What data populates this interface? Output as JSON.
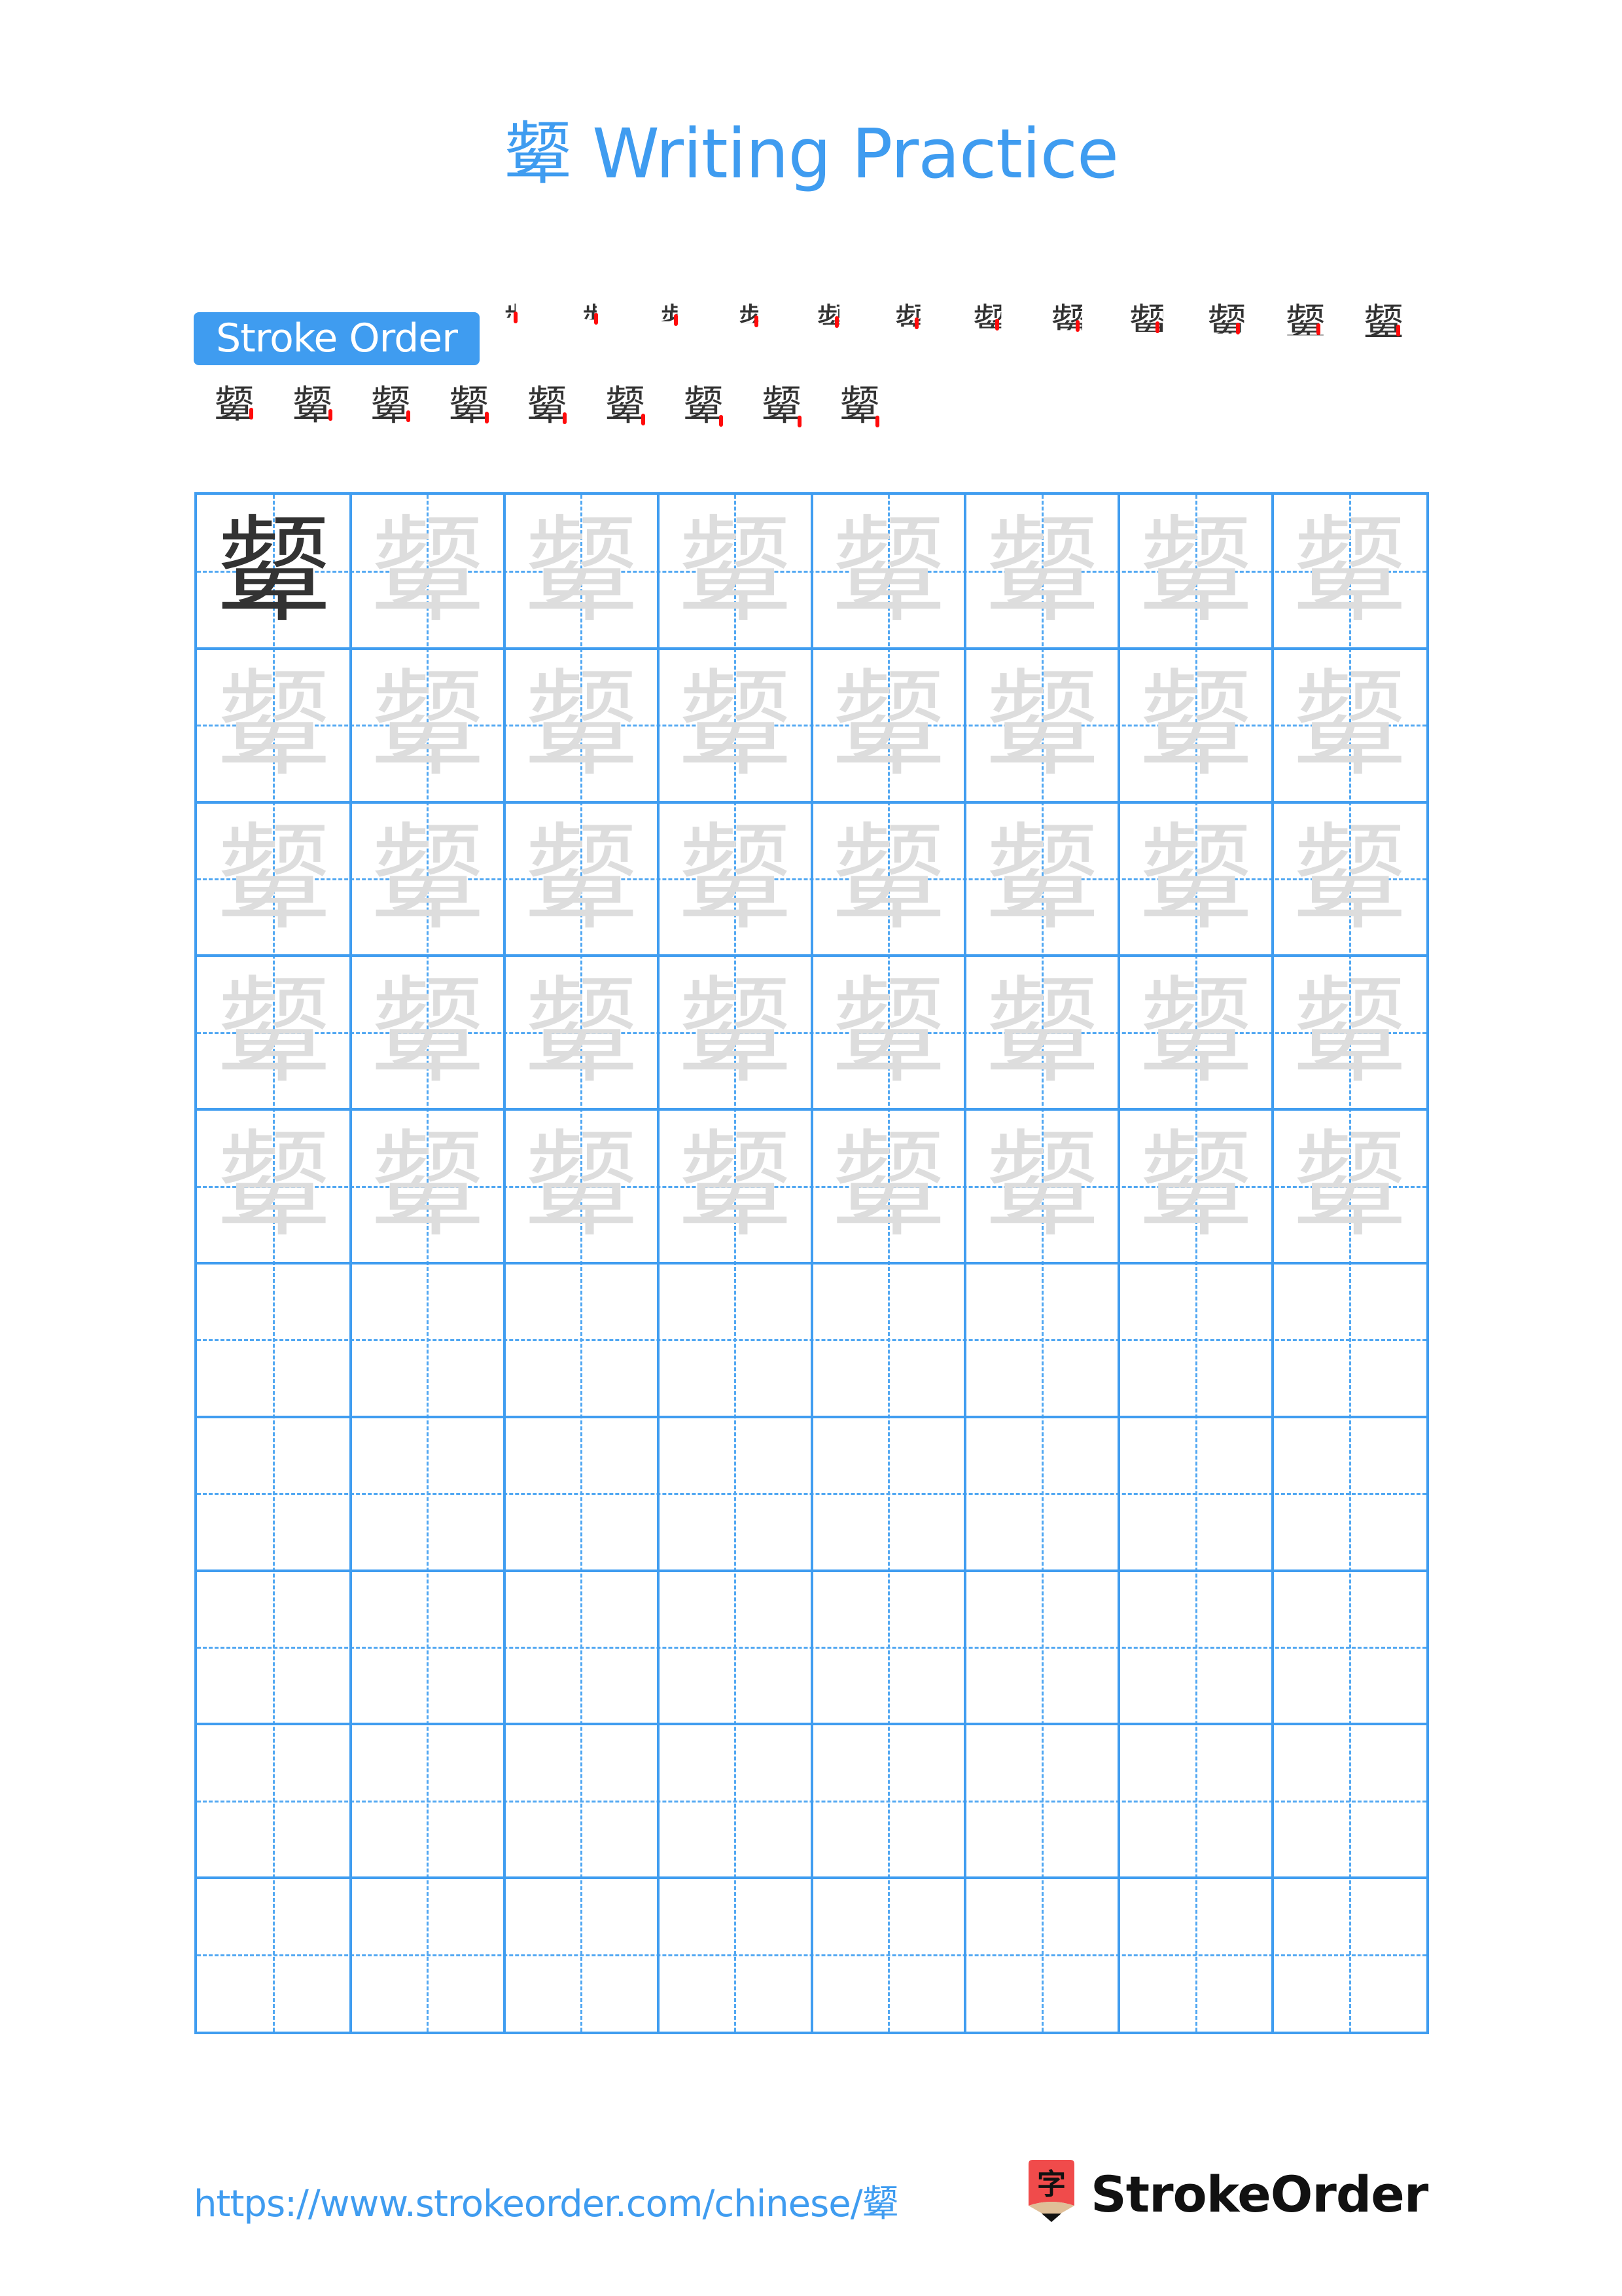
{
  "character": "颦",
  "title": "颦 Writing Practice",
  "stroke_order": {
    "label": "Stroke Order",
    "total_strokes": 21,
    "highlight_color": "#ff0a0a",
    "steps": [
      {
        "n": 1
      },
      {
        "n": 2
      },
      {
        "n": 3
      },
      {
        "n": 4
      },
      {
        "n": 5
      },
      {
        "n": 6
      },
      {
        "n": 7
      },
      {
        "n": 8
      },
      {
        "n": 9
      },
      {
        "n": 10
      },
      {
        "n": 11
      },
      {
        "n": 12
      },
      {
        "n": 13
      },
      {
        "n": 14
      },
      {
        "n": 15
      },
      {
        "n": 16
      },
      {
        "n": 17
      },
      {
        "n": 18
      },
      {
        "n": 19
      },
      {
        "n": 20
      },
      {
        "n": 21
      }
    ]
  },
  "practice_grid": {
    "columns": 8,
    "rows": 10,
    "filled_rows": 5,
    "model_cell": "颦",
    "trace_char": "颦",
    "grid_color": "#409df0",
    "model_color": "#333333",
    "trace_color": "#dddddd"
  },
  "footer": {
    "url": "https://www.strokeorder.com/chinese/颦",
    "brand": "StrokeOrder",
    "logo_glyph": "字"
  },
  "colors": {
    "accent": "#3f9cf0",
    "logo_red": "#f04b4b",
    "logo_tan": "#dfbf98"
  }
}
